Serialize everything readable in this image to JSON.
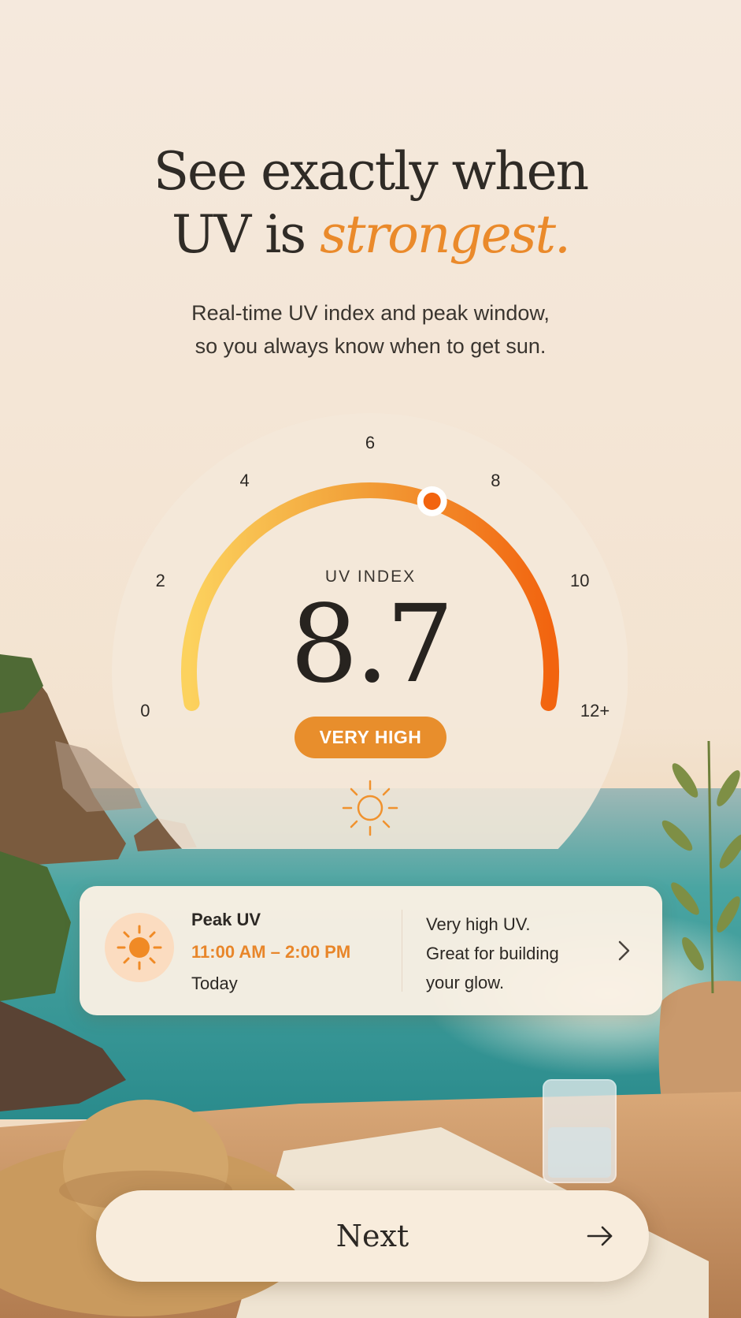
{
  "headline": {
    "line1": "See exactly when",
    "line2_prefix": "UV is ",
    "line2_accent": "strongest."
  },
  "subtitle": {
    "line1": "Real-time UV index and peak window,",
    "line2": "so you always know when to get sun."
  },
  "gauge": {
    "label": "UV INDEX",
    "value": "8.7",
    "value_number": 8.7,
    "max": 12,
    "level": "VERY HIGH",
    "ticks": [
      "0",
      "2",
      "4",
      "6",
      "8",
      "10",
      "12+"
    ],
    "colors": {
      "start": "#fcd25e",
      "mid": "#f2a23a",
      "end": "#f2640f",
      "badge": "#e88e2c"
    }
  },
  "peak": {
    "title": "Peak UV",
    "time": "11:00 AM – 2:00 PM",
    "day": "Today",
    "desc_line1": "Very high UV.",
    "desc_line2": "Great for building",
    "desc_line3": "your glow."
  },
  "next_button": {
    "label": "Next"
  },
  "icons": {
    "gauge_sun": "sun-icon",
    "peak_sun": "sun-filled-icon",
    "chevron": "chevron-right-icon",
    "arrow": "arrow-right-icon"
  }
}
